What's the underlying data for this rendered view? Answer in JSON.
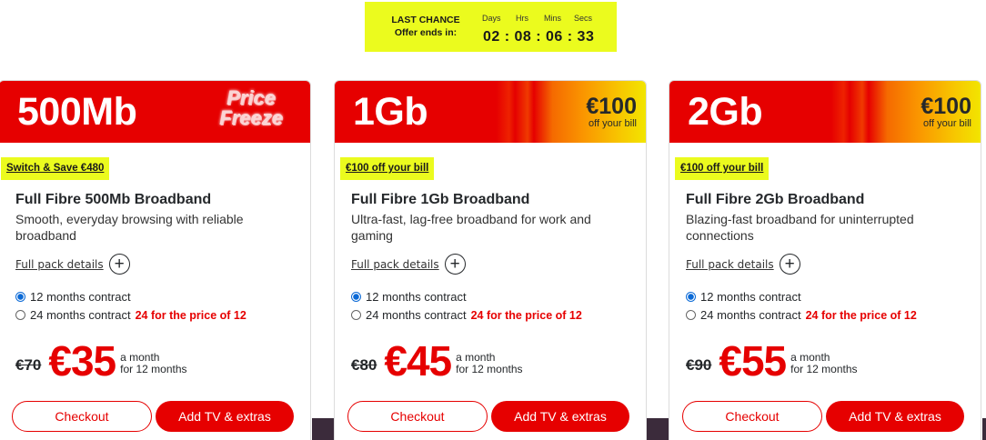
{
  "countdown": {
    "title_line1": "LAST CHANCE",
    "title_line2": "Offer ends in:",
    "units": [
      "Days",
      "Hrs",
      "Mins",
      "Secs"
    ],
    "display": "02 : 08 : 06 : 33",
    "background": "#ebfb1e"
  },
  "colors": {
    "brand_red": "#e60000",
    "highlight_yellow": "#ebfb1e",
    "radio_blue": "#0a69d6"
  },
  "plans": [
    {
      "speed": "500Mb",
      "banner_extra": [
        "Price",
        "Freeze"
      ],
      "tag": "Switch & Save €480",
      "title": "Full Fibre 500Mb Broadband",
      "description": "Smooth, everyday browsing with reliable broadband",
      "details_link": "Full pack details",
      "option_12": "12 months contract",
      "option_24": "24 months contract",
      "option_24_promo": "24 for the price of 12",
      "selected_option": "12 months contract",
      "was_price": "€70",
      "price": "€35",
      "per_line1": "a month",
      "per_line2": "for 12 months",
      "checkout": "Checkout",
      "add_tv": "Add TV & extras"
    },
    {
      "speed": "1Gb",
      "offer_amount": "€100",
      "offer_text": "off your bill",
      "tag": "€100 off your bill",
      "title": "Full Fibre 1Gb Broadband",
      "description": "Ultra-fast, lag-free broadband for work and gaming",
      "details_link": "Full pack details",
      "option_12": "12 months contract",
      "option_24": "24 months contract",
      "option_24_promo": "24 for the price of 12",
      "selected_option": "12 months contract",
      "was_price": "€80",
      "price": "€45",
      "per_line1": "a month",
      "per_line2": "for 12 months",
      "checkout": "Checkout",
      "add_tv": "Add TV & extras"
    },
    {
      "speed": "2Gb",
      "offer_amount": "€100",
      "offer_text": "off your bill",
      "tag": "€100 off your bill",
      "title": "Full Fibre 2Gb Broadband",
      "description": "Blazing-fast broadband for uninterrupted connections",
      "details_link": "Full pack details",
      "option_12": "12 months contract",
      "option_24": "24 months contract",
      "option_24_promo": "24 for the price of 12",
      "selected_option": "12 months contract",
      "was_price": "€90",
      "price": "€55",
      "per_line1": "a month",
      "per_line2": "for 12 months",
      "checkout": "Checkout",
      "add_tv": "Add TV & extras"
    }
  ]
}
